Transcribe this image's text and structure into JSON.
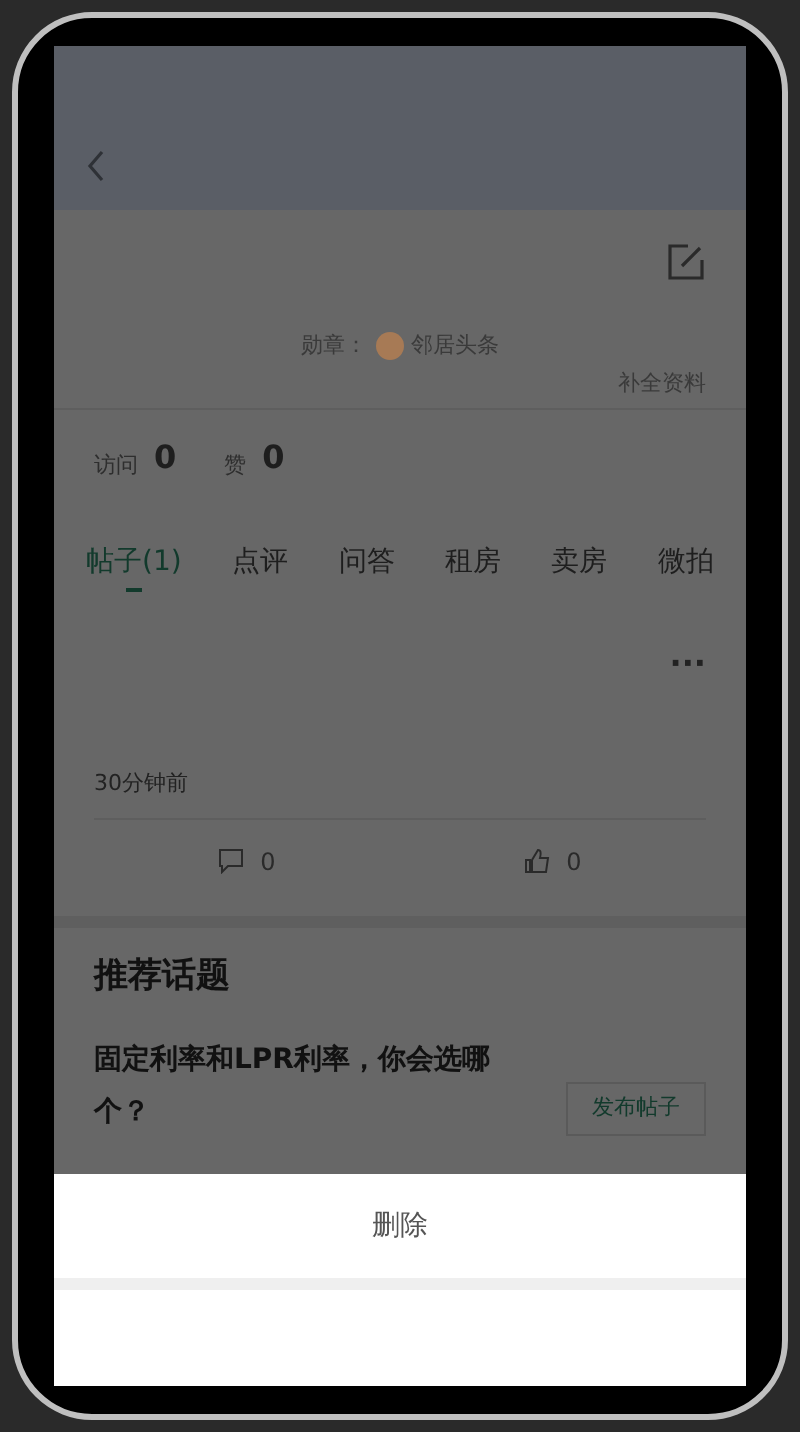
{
  "profile": {
    "medal_label": "勋章：",
    "medal_name": "邻居头条",
    "complete_link": "补全资料",
    "stats": [
      {
        "label": "访问",
        "value": "0"
      },
      {
        "label": "赞",
        "value": "0"
      }
    ]
  },
  "tabs": [
    {
      "label": "帖子(1)",
      "selected": true
    },
    {
      "label": "点评",
      "selected": false
    },
    {
      "label": "问答",
      "selected": false
    },
    {
      "label": "租房",
      "selected": false
    },
    {
      "label": "卖房",
      "selected": false
    },
    {
      "label": "微拍",
      "selected": false
    }
  ],
  "post": {
    "more": "···",
    "time": "30分钟前",
    "comments": "0",
    "likes": "0"
  },
  "recommended": {
    "title": "推荐话题",
    "topic": "固定利率和LPR利率，你会选哪个？",
    "button": "发布帖子"
  },
  "action_sheet": {
    "options": [
      "删除"
    ]
  }
}
